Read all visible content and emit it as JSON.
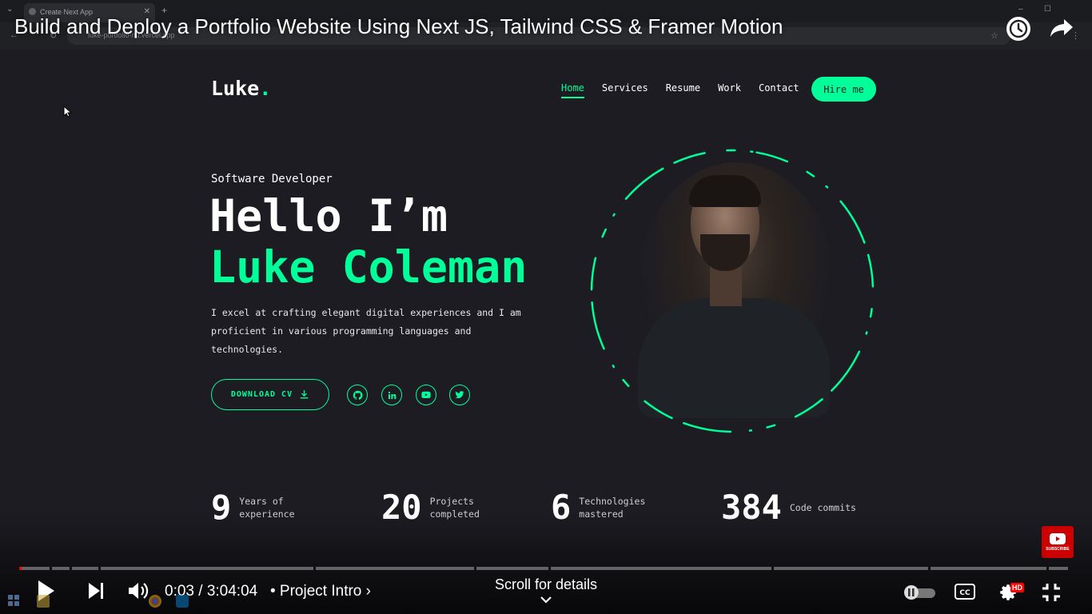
{
  "browser": {
    "tab_title": "Create Next App",
    "address": "luke-portfolio-nu.vercel.app",
    "new_tab_icon": "plus-icon",
    "close_icon": "close-icon"
  },
  "site": {
    "logo": "Luke",
    "logo_dot": ".",
    "nav": [
      "Home",
      "Services",
      "Resume",
      "Work",
      "Contact"
    ],
    "active_nav": "Home",
    "hire_label": "Hire me",
    "role": "Software Developer",
    "greeting": "Hello I’m",
    "name": "Luke Coleman",
    "bio": "I excel at crafting elegant digital experiences and I am proficient in various programming languages and technologies.",
    "cv_label": "DOWNLOAD CV",
    "socials": [
      "github-icon",
      "linkedin-icon",
      "youtube-icon",
      "twitter-icon"
    ],
    "stats": [
      {
        "num": "9",
        "label": "Years of experience"
      },
      {
        "num": "20",
        "label": "Projects completed"
      },
      {
        "num": "6",
        "label": "Technologies mastered"
      },
      {
        "num": "384",
        "label": "Code commits"
      }
    ],
    "accent": "#00ff99",
    "background": "#1c1c22"
  },
  "player": {
    "title": "Build and Deploy a Portfolio Website Using Next JS, Tailwind CSS & Framer Motion",
    "time": "0:03 / 3:04:04",
    "chapter": "• Project Intro",
    "scroll_hint": "Scroll for details",
    "hd_badge": "HD",
    "subscribe_label": "SUBSCRIBE",
    "progress_fraction": 0.0003,
    "accent": "#ff0000"
  }
}
